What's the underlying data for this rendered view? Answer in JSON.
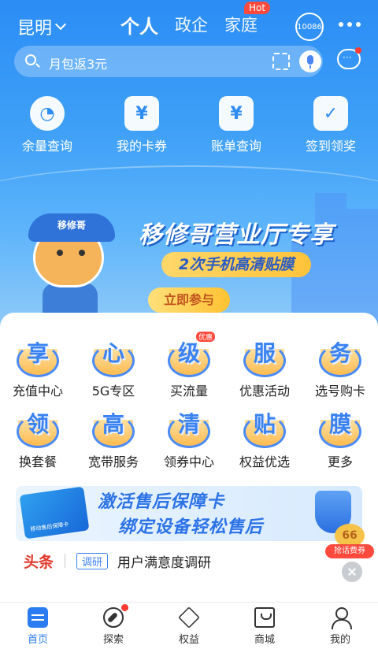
{
  "topbar": {
    "city": "昆明",
    "segments": [
      "个人",
      "政企",
      "家庭"
    ],
    "hot_badge": "Hot",
    "service_number": "10086"
  },
  "search": {
    "placeholder": "月包返3元"
  },
  "quick_actions": [
    {
      "label": "余量查询",
      "icon": "pie-chart-icon"
    },
    {
      "label": "我的卡券",
      "icon": "coupon-icon"
    },
    {
      "label": "账单查询",
      "icon": "bill-icon"
    },
    {
      "label": "签到领奖",
      "icon": "calendar-check-icon"
    }
  ],
  "banner": {
    "cap_text": "移修哥",
    "title": "移修哥营业厅专享",
    "subtitle": "2次手机高清贴膜",
    "cta": "立即参与"
  },
  "services": [
    {
      "label": "充值中心",
      "glyph": "享"
    },
    {
      "label": "5G专区",
      "glyph": "心"
    },
    {
      "label": "买流量",
      "glyph": "级",
      "badge": "优惠"
    },
    {
      "label": "优惠活动",
      "glyph": "服"
    },
    {
      "label": "选号购卡",
      "glyph": "务"
    },
    {
      "label": "换套餐",
      "glyph": "领"
    },
    {
      "label": "宽带服务",
      "glyph": "高"
    },
    {
      "label": "领券中心",
      "glyph": "清"
    },
    {
      "label": "权益优选",
      "glyph": "贴"
    },
    {
      "label": "更多",
      "glyph": "膜"
    }
  ],
  "promo": {
    "line1": "激活售后保障卡",
    "line2": "绑定设备轻松售后",
    "card_text": "移动售后保障卡"
  },
  "headline": {
    "tag": "头条",
    "badge": "调研",
    "text": "用户满意度调研"
  },
  "float_ad": {
    "coin": "66",
    "tag": "抢话费券"
  },
  "tabs": [
    {
      "label": "首页",
      "active": true
    },
    {
      "label": "探索"
    },
    {
      "label": "权益"
    },
    {
      "label": "商城"
    },
    {
      "label": "我的"
    }
  ],
  "colors": {
    "primary": "#2b7cf0",
    "accent_red": "#e13a2d",
    "banner_yellow": "#ffc33a"
  }
}
